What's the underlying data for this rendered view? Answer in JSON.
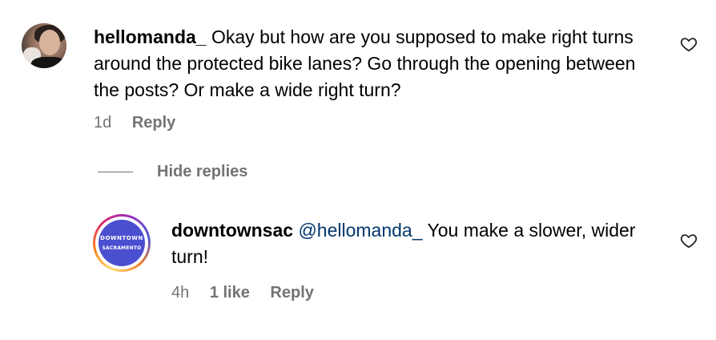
{
  "comment": {
    "username": "hellomanda_",
    "text": "Okay but how are you supposed to make right turns around the protected bike lanes? Go through the opening between the posts? Or make a wide right turn?",
    "time": "1d",
    "reply_label": "Reply",
    "like_icon": "heart-icon"
  },
  "thread": {
    "hide_replies_label": "Hide replies"
  },
  "reply": {
    "username": "downtownsac",
    "mention": "@hellomanda_",
    "text": " You make a slower, wider turn!",
    "time": "4h",
    "likes": "1 like",
    "reply_label": "Reply",
    "like_icon": "heart-icon",
    "avatar_logo": {
      "line1": "DOWNTOWN",
      "line2": "SACRAMENTO",
      "bg_color": "#4a4fd0"
    }
  }
}
